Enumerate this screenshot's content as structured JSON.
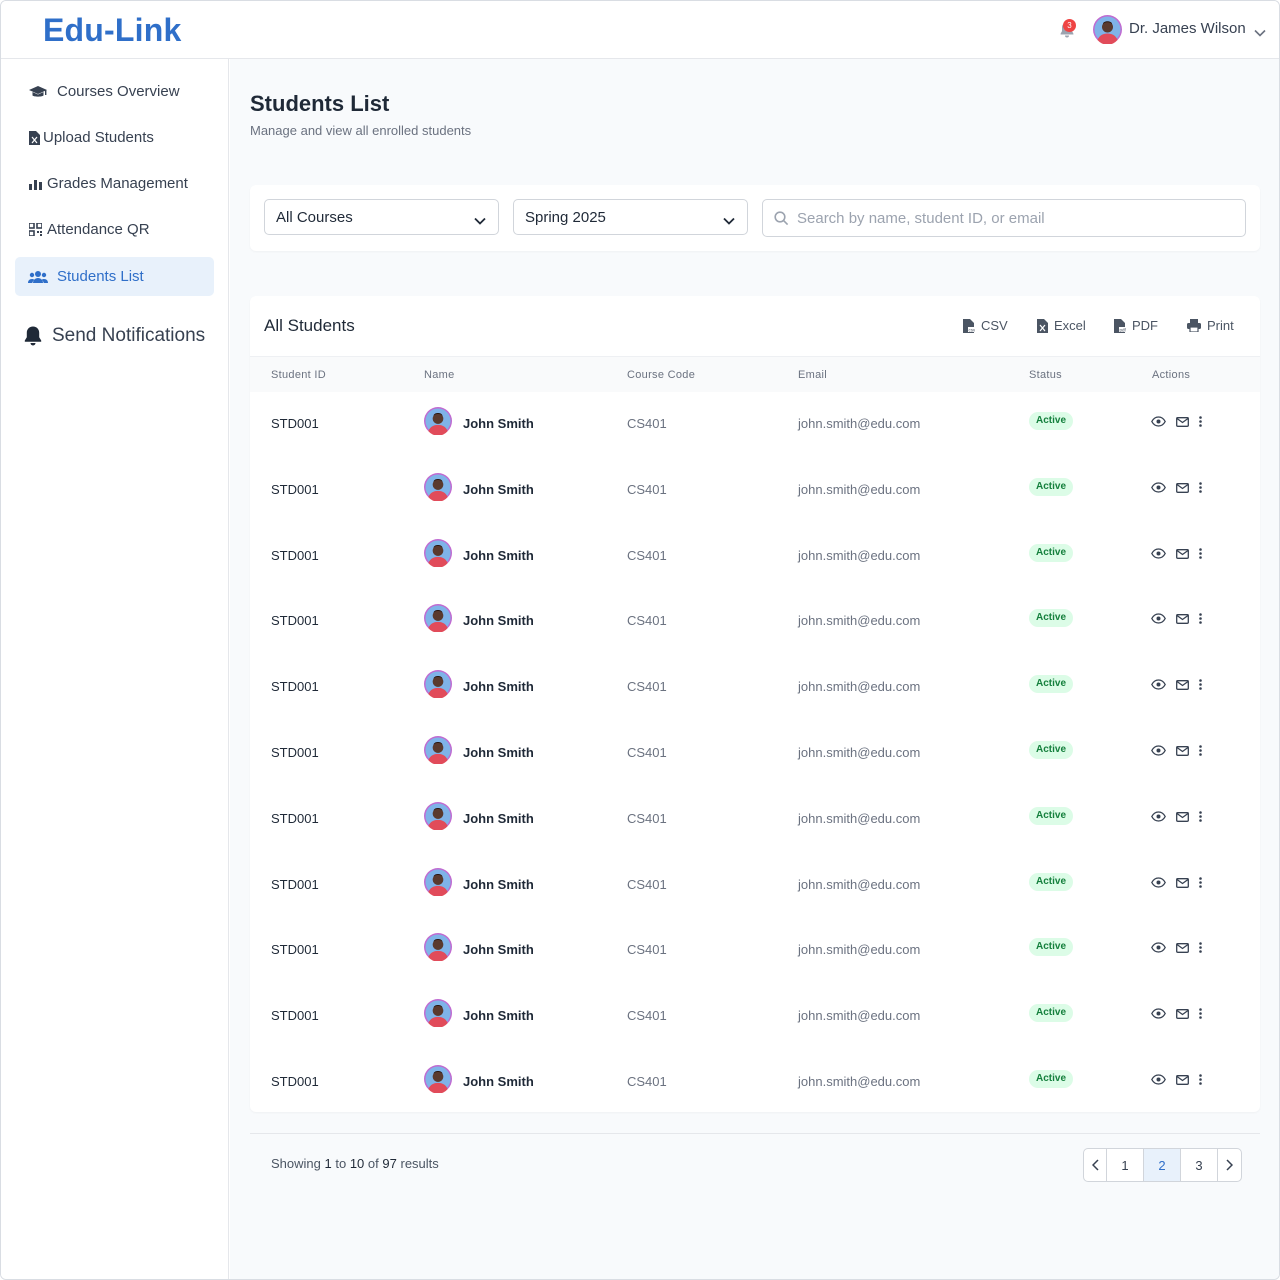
{
  "app": {
    "brand": "Edu-Link"
  },
  "header": {
    "notification_count": "3",
    "user_name": "Dr. James Wilson"
  },
  "sidebar": {
    "items": [
      {
        "label": "Courses Overview",
        "icon": "graduation-cap-icon"
      },
      {
        "label": "Upload Students",
        "icon": "excel-file-icon"
      },
      {
        "label": "Grades Management",
        "icon": "bar-chart-icon"
      },
      {
        "label": "Attendance QR",
        "icon": "qr-code-icon"
      },
      {
        "label": "Students List",
        "icon": "users-icon",
        "active": true
      }
    ],
    "notify_label": "Send Notifications"
  },
  "page": {
    "title": "Students List",
    "subtitle": "Manage and view all enrolled students"
  },
  "filters": {
    "course_select": "All Courses",
    "semester_select": "Spring 2025",
    "search_placeholder": "Search by name, student ID, or email"
  },
  "table": {
    "title": "All Students",
    "exports": [
      "CSV",
      "Excel",
      "PDF",
      "Print"
    ],
    "columns": [
      "Student ID",
      "Name",
      "Course Code",
      "Email",
      "Status",
      "Actions"
    ],
    "rows": [
      {
        "id": "STD001",
        "name": "John Smith",
        "course": "CS401",
        "email": "john.smith@edu.com",
        "status": "Active"
      },
      {
        "id": "STD001",
        "name": "John Smith",
        "course": "CS401",
        "email": "john.smith@edu.com",
        "status": "Active"
      },
      {
        "id": "STD001",
        "name": "John Smith",
        "course": "CS401",
        "email": "john.smith@edu.com",
        "status": "Active"
      },
      {
        "id": "STD001",
        "name": "John Smith",
        "course": "CS401",
        "email": "john.smith@edu.com",
        "status": "Active"
      },
      {
        "id": "STD001",
        "name": "John Smith",
        "course": "CS401",
        "email": "john.smith@edu.com",
        "status": "Active"
      },
      {
        "id": "STD001",
        "name": "John Smith",
        "course": "CS401",
        "email": "john.smith@edu.com",
        "status": "Active"
      },
      {
        "id": "STD001",
        "name": "John Smith",
        "course": "CS401",
        "email": "john.smith@edu.com",
        "status": "Active"
      },
      {
        "id": "STD001",
        "name": "John Smith",
        "course": "CS401",
        "email": "john.smith@edu.com",
        "status": "Active"
      },
      {
        "id": "STD001",
        "name": "John Smith",
        "course": "CS401",
        "email": "john.smith@edu.com",
        "status": "Active"
      },
      {
        "id": "STD001",
        "name": "John Smith",
        "course": "CS401",
        "email": "john.smith@edu.com",
        "status": "Active"
      },
      {
        "id": "STD001",
        "name": "John Smith",
        "course": "CS401",
        "email": "john.smith@edu.com",
        "status": "Active"
      }
    ]
  },
  "pagination": {
    "showing_prefix": "Showing",
    "from": "1",
    "to_word": "to",
    "to": "10",
    "of_word": "of",
    "total": "97",
    "suffix": "results",
    "pages": [
      "1",
      "2",
      "3"
    ],
    "current_page": "2"
  },
  "colors": {
    "brand": "#2f6fc9",
    "active_bg": "#e8f1fb",
    "status_bg": "#dcfce7",
    "status_text": "#15803d",
    "badge": "#ef4444"
  }
}
